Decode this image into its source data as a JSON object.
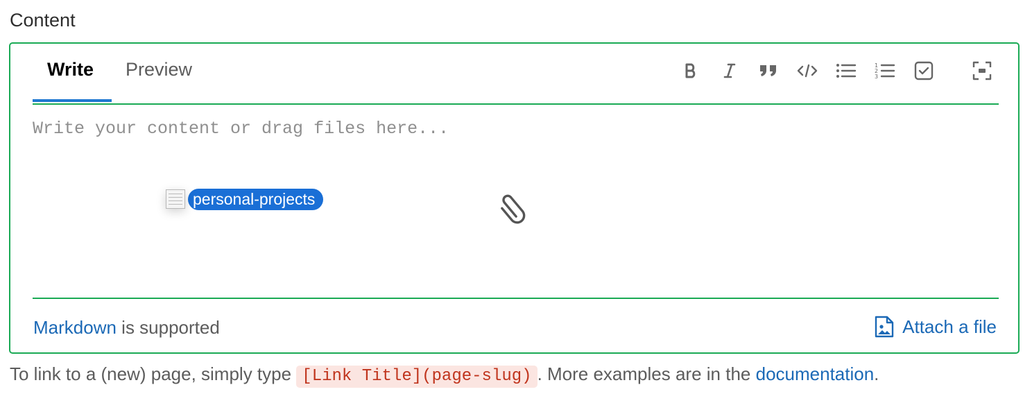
{
  "field_label": "Content",
  "tabs": {
    "write": "Write",
    "preview": "Preview"
  },
  "toolbar": [
    {
      "name": "bold",
      "icon": "bold-icon"
    },
    {
      "name": "italic",
      "icon": "italic-icon"
    },
    {
      "name": "quote",
      "icon": "quote-icon"
    },
    {
      "name": "code",
      "icon": "code-icon"
    },
    {
      "name": "bullet-list",
      "icon": "bullet-list-icon"
    },
    {
      "name": "numbered-list",
      "icon": "numbered-list-icon"
    },
    {
      "name": "task-list",
      "icon": "task-list-icon"
    },
    {
      "name": "fullscreen",
      "icon": "fullscreen-icon"
    }
  ],
  "editor": {
    "value": "",
    "placeholder": "Write your content or drag files here..."
  },
  "drag": {
    "item_label": "personal-projects"
  },
  "footer": {
    "markdown_link": "Markdown",
    "markdown_suffix": " is supported",
    "attach_label": "Attach a file"
  },
  "help": {
    "prefix": "To link to a (new) page, simply type ",
    "code": "[Link Title](page-slug)",
    "middle": ". More examples are in the ",
    "link": "documentation",
    "suffix": "."
  },
  "colors": {
    "border_active": "#1aaa55",
    "link": "#1b69b6",
    "tab_underline": "#1f78d1",
    "drag_pill": "#1a6fd6",
    "code_bg": "#fbe5e1",
    "code_text": "#c0341d"
  }
}
